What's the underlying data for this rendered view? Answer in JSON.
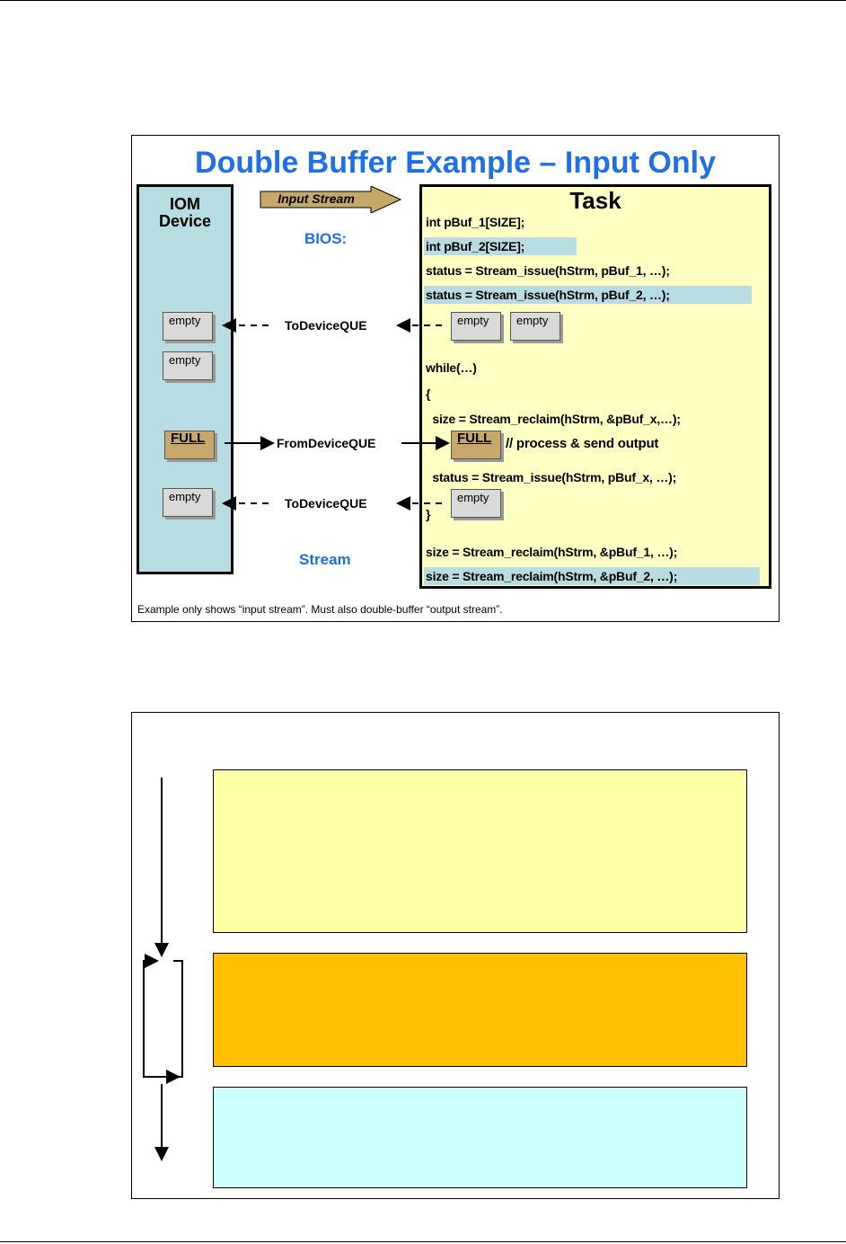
{
  "slide1": {
    "title": "Double Buffer Example – Input Only",
    "iom_title_line1": "IOM",
    "iom_title_line2": "Device",
    "input_stream_label": "Input Stream",
    "bios_label": "BIOS:",
    "stream_label": "Stream",
    "task_title": "Task",
    "code_lines": [
      "int pBuf_1[SIZE];",
      "int pBuf_2[SIZE];",
      "status = Stream_issue(hStrm, pBuf_1, …);",
      "status = Stream_issue(hStrm, pBuf_2, …);",
      "while(…)",
      "{",
      "  size = Stream_reclaim(hStrm, &pBuf_x,…);",
      "// process & send output",
      "  status = Stream_issue(hStrm, pBuf_x, …);",
      "}",
      "size = Stream_reclaim(hStrm, &pBuf_1, …);",
      "size = Stream_reclaim(hStrm, &pBuf_2, …);"
    ],
    "queue_labels": {
      "to_device_top": "ToDeviceQUE",
      "from_device": "FromDeviceQUE",
      "to_device_bottom": "ToDeviceQUE"
    },
    "buffer_labels": {
      "empty": "empty",
      "full": "FULL"
    },
    "footnote": "Example only shows “input stream”. Must also double-buffer “output stream”.",
    "colors": {
      "title_blue": "#1f6fe6",
      "iom_fill": "#b7dde2",
      "task_fill": "#ffffc4",
      "highlight": "#b7dde2",
      "full_buffer": "#c6a86b",
      "empty_buffer": "#d9d9d9"
    }
  },
  "slide2": {
    "colors": {
      "box_top": "#ffffa6",
      "box_middle": "#ffc000",
      "box_bottom": "#ccffff"
    }
  }
}
